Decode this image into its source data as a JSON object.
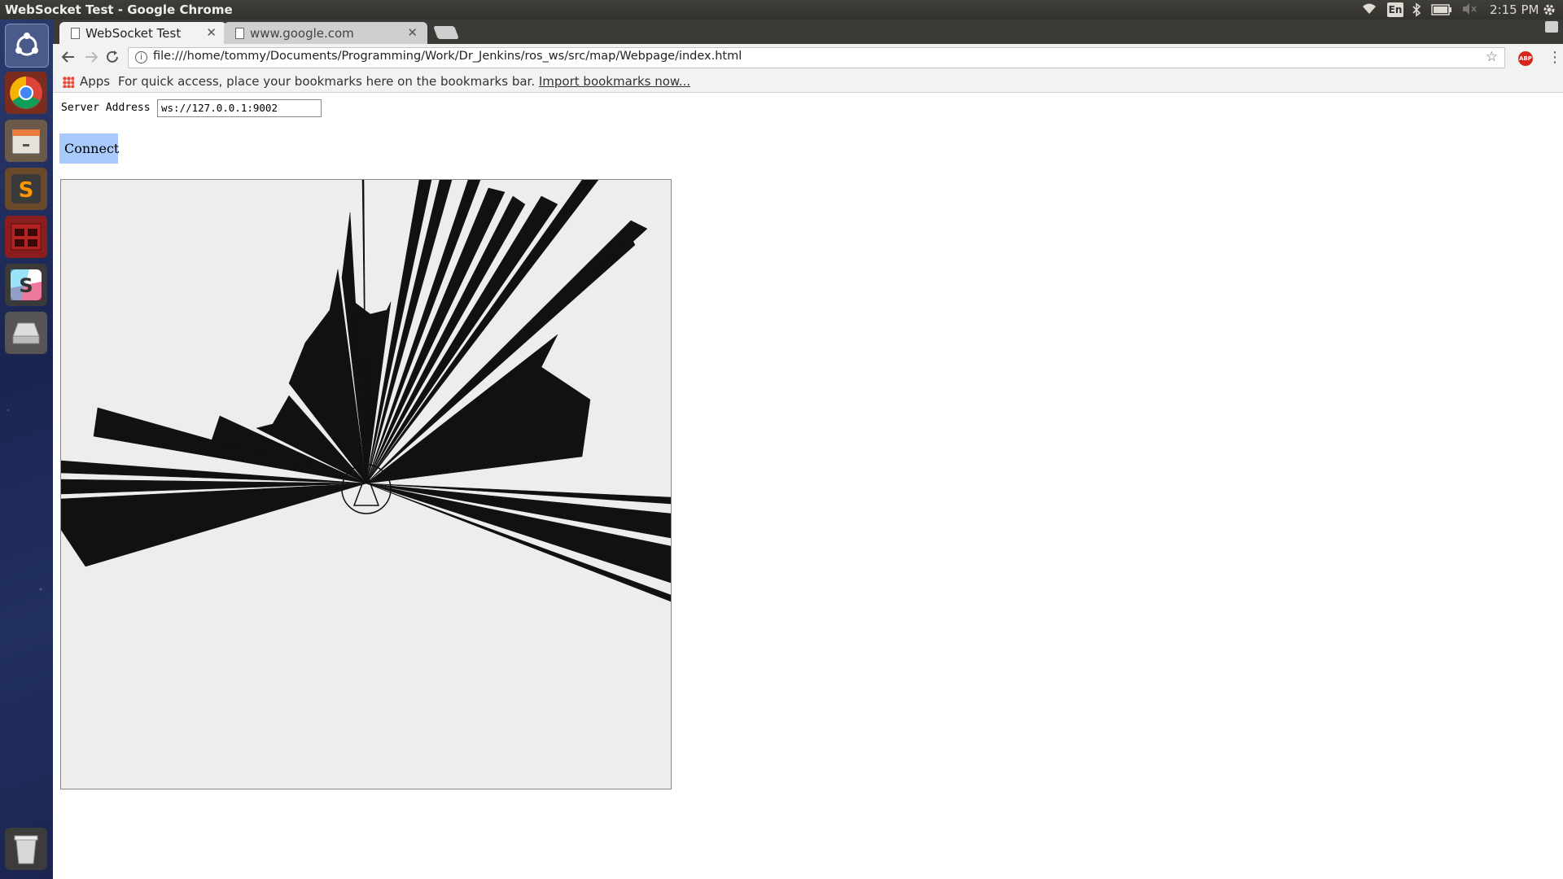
{
  "os": {
    "window_title": "WebSocket Test - Google Chrome",
    "indicators": {
      "wifi_icon": "wifi-icon",
      "lang": "En",
      "bluetooth_icon": "bluetooth-icon",
      "battery_icon": "battery-icon",
      "volume_icon": "volume-muted-icon"
    },
    "clock": "2:15 PM"
  },
  "launcher": {
    "items": [
      "ubuntu-dash",
      "chrome",
      "files",
      "sublime-text",
      "terminal",
      "slack",
      "disk",
      "trash"
    ]
  },
  "browser": {
    "tabs": [
      {
        "label": "WebSocket Test",
        "active": true
      },
      {
        "label": "www.google.com",
        "active": false
      }
    ],
    "url": "file:///home/tommy/Documents/Programming/Work/Dr_Jenkins/ros_ws/src/map/Webpage/index.html",
    "bookmarks": {
      "apps_label": "Apps",
      "message": "For quick access, place your bookmarks here on the bookmarks bar.",
      "import_link": "Import bookmarks now..."
    },
    "abp_label": "ABP"
  },
  "page": {
    "server_label": "Server Address",
    "server_value": "ws://127.0.0.1:9002",
    "connect_label": "Connect"
  }
}
